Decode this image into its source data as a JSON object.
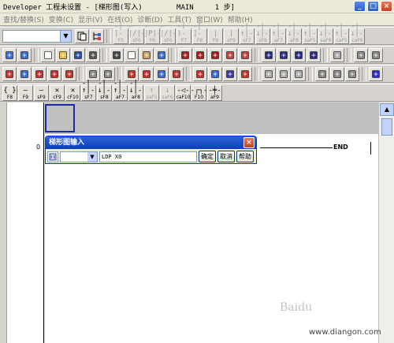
{
  "window": {
    "title": "Developer 工程未设置 - [梯形图(写入)        MAIN     1 步]",
    "minimize": "_",
    "maximize": "□",
    "close": "×"
  },
  "menu": {
    "items": [
      {
        "label": "查找/替换(S)",
        "active": false
      },
      {
        "label": "变换(C)",
        "active": false
      },
      {
        "label": "显示(V)",
        "active": false
      },
      {
        "label": "在线(O)",
        "active": false
      },
      {
        "label": "诊断(D)",
        "active": false
      },
      {
        "label": "工具(T)",
        "active": false
      },
      {
        "label": "窗口(W)",
        "active": false
      },
      {
        "label": "帮助(H)",
        "active": false
      }
    ]
  },
  "toolbar_ladder": {
    "fkeys": [
      {
        "sym": "-| |-",
        "key": "F5"
      },
      {
        "sym": "-|/|-",
        "key": "sF6"
      },
      {
        "sym": "-|P|-",
        "key": "F6"
      },
      {
        "sym": "-|/|-",
        "key": "sF6"
      },
      {
        "sym": "-( )-",
        "key": "F7"
      },
      {
        "sym": "-[ ]-",
        "key": "F8"
      },
      {
        "sym": "|",
        "key": "F9"
      },
      {
        "sym": "|",
        "key": "sF9"
      },
      {
        "sym": "-|↑|-",
        "key": "sF7"
      },
      {
        "sym": "-|↓|-",
        "key": "sF8"
      },
      {
        "sym": "-|↑|-",
        "key": "aF7"
      },
      {
        "sym": "-|↓|-",
        "key": "aF8"
      },
      {
        "sym": "-|↑|-",
        "key": "saF5"
      },
      {
        "sym": "-|↓|-",
        "key": "saF6"
      },
      {
        "sym": "-|↑|-",
        "key": "caF5"
      },
      {
        "sym": "-|↓|-",
        "key": "caF6"
      }
    ]
  },
  "toolbar_bottom": {
    "fkeys": [
      {
        "sym": "{ }",
        "key": "F8"
      },
      {
        "sym": "—",
        "key": "F9"
      },
      {
        "sym": "—",
        "key": "sF9"
      },
      {
        "sym": "✕",
        "key": "cF9"
      },
      {
        "sym": "✕",
        "key": "cF10"
      },
      {
        "sym": "-|↑|-",
        "key": "sF7"
      },
      {
        "sym": "-|↓|-",
        "key": "sF8"
      },
      {
        "sym": "-|↑|-",
        "key": "aF7"
      },
      {
        "sym": "-|↓|-",
        "key": "aF8"
      },
      {
        "sym": "↑",
        "key": "saF5"
      },
      {
        "sym": "↓",
        "key": "saF6"
      },
      {
        "sym": "-◁-",
        "key": "caF10"
      },
      {
        "sym": "-┌┐-",
        "key": "F10"
      },
      {
        "sym": "-╪-",
        "key": "aF9"
      }
    ]
  },
  "ladder": {
    "step": "0",
    "end": "END"
  },
  "dialog": {
    "title": "梯形图输入",
    "instruction": "LDP X0",
    "ok": "确定",
    "cancel": "取消",
    "help": "帮助"
  },
  "watermark": {
    "brand": "Baidu",
    "url": "www.diangon.com"
  }
}
